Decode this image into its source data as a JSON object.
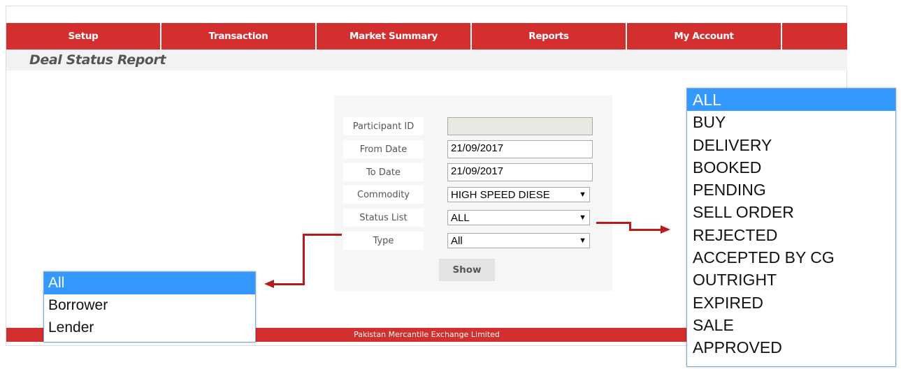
{
  "nav": {
    "items": [
      {
        "label": "Setup"
      },
      {
        "label": "Transaction"
      },
      {
        "label": "Market Summary"
      },
      {
        "label": "Reports"
      },
      {
        "label": "My Account"
      },
      {
        "label": ""
      }
    ]
  },
  "page": {
    "title": "Deal Status Report"
  },
  "form": {
    "participant_id": {
      "label": "Participant ID",
      "value": ""
    },
    "from_date": {
      "label": "From Date",
      "value": "21/09/2017"
    },
    "to_date": {
      "label": "To Date",
      "value": "21/09/2017"
    },
    "commodity": {
      "label": "Commodity",
      "value": "HIGH SPEED DIESE"
    },
    "status_list": {
      "label": "Status List",
      "value": "ALL"
    },
    "type": {
      "label": "Type",
      "value": "All"
    },
    "show_label": "Show"
  },
  "footer": {
    "text": "Pakistan Mercantile Exchange Limited"
  },
  "type_dropdown": {
    "options": [
      "All",
      "Borrower",
      "Lender"
    ],
    "selected": "All"
  },
  "status_dropdown": {
    "options": [
      "ALL",
      "BUY",
      "DELIVERY",
      "BOOKED",
      "PENDING",
      "SELL ORDER",
      "REJECTED",
      "ACCEPTED BY CG",
      "OUTRIGHT",
      "EXPIRED",
      "SALE",
      "APPROVED"
    ],
    "selected": "ALL"
  },
  "colors": {
    "brand_red": "#d32f2f",
    "arrow_red": "#b71c1c",
    "selection_blue": "#3399ff"
  }
}
